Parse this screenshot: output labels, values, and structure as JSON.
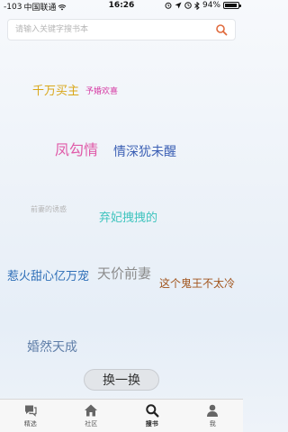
{
  "status_bar": {
    "signal": "-103",
    "carrier": "中国联通",
    "time": "16:26",
    "battery": "94%"
  },
  "search": {
    "placeholder": "请输入关键字搜书本"
  },
  "tags": [
    {
      "text": "千万买主",
      "color": "#d9a617"
    },
    {
      "text": "予婚欢喜",
      "color": "#d63aa3"
    },
    {
      "text": "凤勾情",
      "color": "#e05aa8"
    },
    {
      "text": "情深犹未醒",
      "color": "#3b5fb4"
    },
    {
      "text": "前妻的诱惑",
      "color": "#b5b5b5"
    },
    {
      "text": "弃妃拽拽的",
      "color": "#3fc4be"
    },
    {
      "text": "惹火甜心亿万宠",
      "color": "#2f6fb8"
    },
    {
      "text": "天价前妻",
      "color": "#8c8c8c"
    },
    {
      "text": "这个鬼王不太冷",
      "color": "#a1541c"
    },
    {
      "text": "婚然天成",
      "color": "#5f7ea8"
    }
  ],
  "refresh_label": "换一换",
  "tabbar": [
    {
      "label": "精选",
      "icon": "chat-bubble-icon"
    },
    {
      "label": "社区",
      "icon": "home-icon"
    },
    {
      "label": "搜书",
      "icon": "search-icon"
    },
    {
      "label": "我",
      "icon": "person-icon"
    }
  ],
  "colors": {
    "accent_search": "#e06a3c"
  }
}
